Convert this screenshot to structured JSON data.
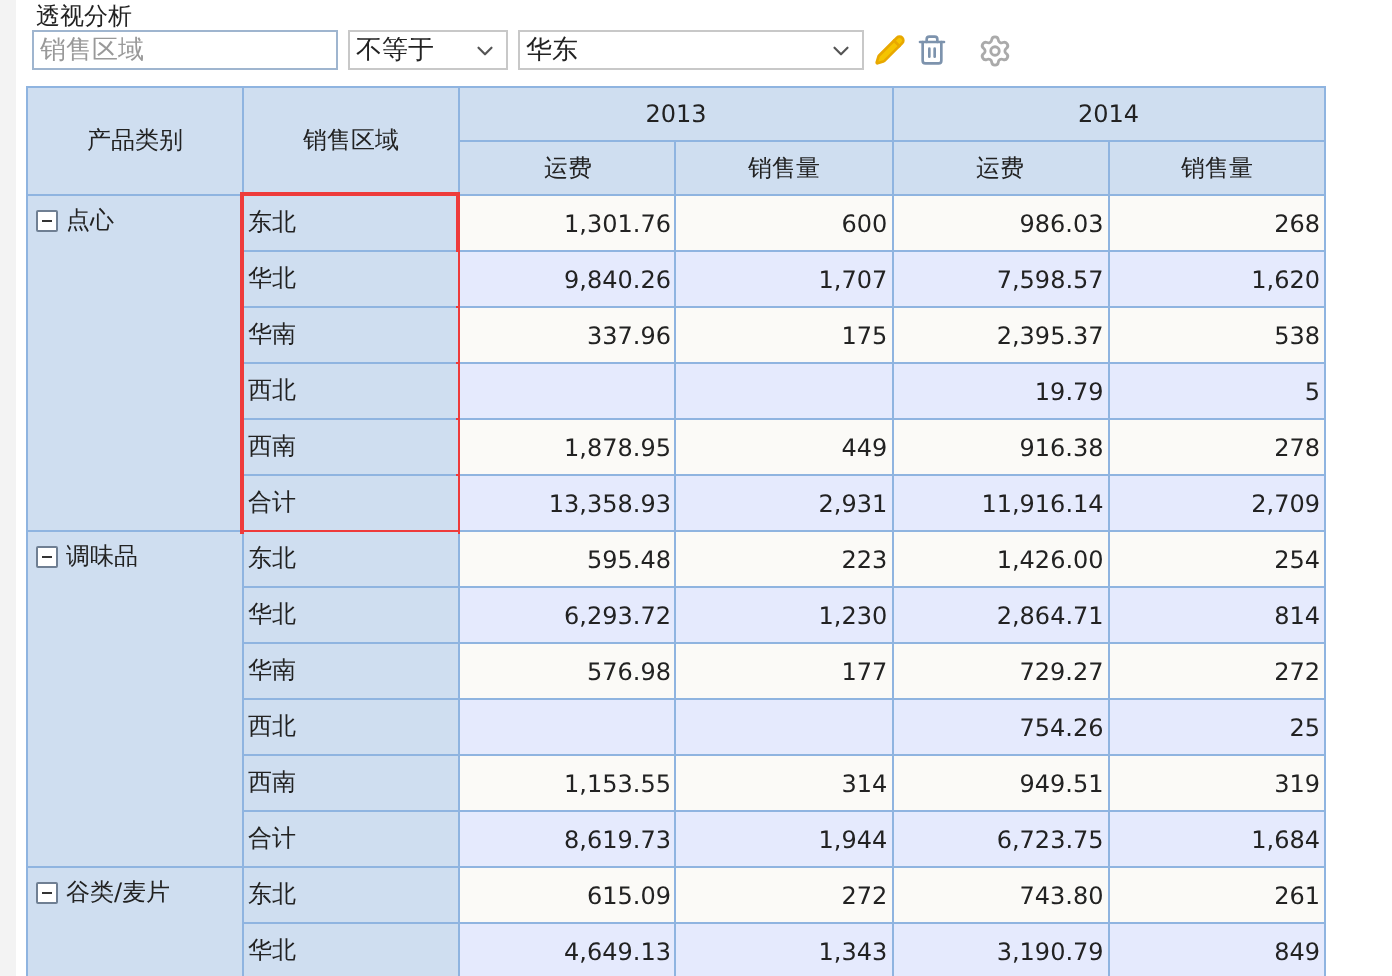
{
  "title": "透视分析",
  "filter": {
    "field": {
      "placeholder": "销售区域"
    },
    "operator": {
      "value": "不等于"
    },
    "value": {
      "value": "华东"
    }
  },
  "table": {
    "columns": [
      "产品类别",
      "销售区域"
    ],
    "years": [
      {
        "label": "2013",
        "measures": [
          "运费",
          "销售量"
        ]
      },
      {
        "label": "2014",
        "measures": [
          "运费",
          "销售量"
        ]
      }
    ],
    "groups": [
      {
        "category": "点心",
        "expanded": true,
        "highlighted": true,
        "rows": [
          {
            "region": "东北",
            "freight_2013": "1,301.76",
            "sales_2013": "600",
            "freight_2014": "986.03",
            "sales_2014": "268"
          },
          {
            "region": "华北",
            "freight_2013": "9,840.26",
            "sales_2013": "1,707",
            "freight_2014": "7,598.57",
            "sales_2014": "1,620"
          },
          {
            "region": "华南",
            "freight_2013": "337.96",
            "sales_2013": "175",
            "freight_2014": "2,395.37",
            "sales_2014": "538"
          },
          {
            "region": "西北",
            "freight_2014": "19.79",
            "sales_2014": "5"
          },
          {
            "region": "西南",
            "freight_2013": "1,878.95",
            "sales_2013": "449",
            "freight_2014": "916.38",
            "sales_2014": "278"
          },
          {
            "region": "合计",
            "freight_2013": "13,358.93",
            "sales_2013": "2,931",
            "freight_2014": "11,916.14",
            "sales_2014": "2,709"
          }
        ]
      },
      {
        "category": "调味品",
        "expanded": true,
        "highlighted": false,
        "rows": [
          {
            "region": "东北",
            "freight_2013": "595.48",
            "sales_2013": "223",
            "freight_2014": "1,426.00",
            "sales_2014": "254"
          },
          {
            "region": "华北",
            "freight_2013": "6,293.72",
            "sales_2013": "1,230",
            "freight_2014": "2,864.71",
            "sales_2014": "814"
          },
          {
            "region": "华南",
            "freight_2013": "576.98",
            "sales_2013": "177",
            "freight_2014": "729.27",
            "sales_2014": "272"
          },
          {
            "region": "西北",
            "freight_2014": "754.26",
            "sales_2014": "25"
          },
          {
            "region": "西南",
            "freight_2013": "1,153.55",
            "sales_2013": "314",
            "freight_2014": "949.51",
            "sales_2014": "319"
          },
          {
            "region": "合计",
            "freight_2013": "8,619.73",
            "sales_2013": "1,944",
            "freight_2014": "6,723.75",
            "sales_2014": "1,684"
          }
        ]
      },
      {
        "category": "谷类/麦片",
        "expanded": true,
        "highlighted": false,
        "rows": [
          {
            "region": "东北",
            "freight_2013": "615.09",
            "sales_2013": "272",
            "freight_2014": "743.80",
            "sales_2014": "261"
          },
          {
            "region": "华北",
            "freight_2013": "4,649.13",
            "sales_2013": "1,343",
            "freight_2014": "3,190.79",
            "sales_2014": "849"
          }
        ]
      }
    ]
  }
}
